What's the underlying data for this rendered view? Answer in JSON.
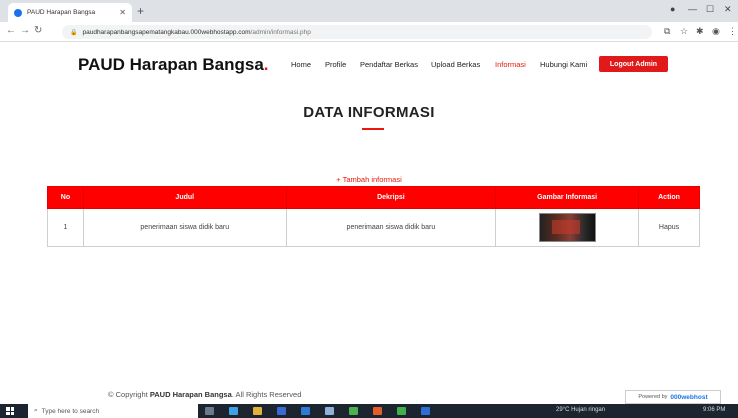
{
  "browser": {
    "tab_title": "PAUD Harapan Bangsa",
    "url_host": "paudharapanbangsapematangkabau.000webhostapp.com",
    "url_path": "/admin/informasi.php"
  },
  "site": {
    "brand": "PAUD Harapan Bangsa",
    "brand_dot": ".",
    "menu": [
      "Home",
      "Profile",
      "Pendaftar Berkas",
      "Upload Berkas",
      "Informasi",
      "Hubungi Kami"
    ],
    "logout_label": "Logout Admin"
  },
  "main": {
    "title": "DATA INFORMASI",
    "add_link": "+  Tambah informasi",
    "table": {
      "headers": [
        "No",
        "Judul",
        "Dekripsi",
        "Gambar Informasi",
        "Action"
      ],
      "rows": [
        {
          "no": "1",
          "judul": "penerimaan siswa didik baru",
          "deskripsi": "penerimaan siswa didik baru",
          "action": "Hapus"
        }
      ]
    }
  },
  "footer": {
    "copyright_prefix": "© Copyright",
    "copyright_brand": "PAUD Harapan Bangsa",
    "copyright_suffix": ". All Rights Reserved",
    "powered_by": "Powered by",
    "powered_host": "000webhost"
  },
  "taskbar": {
    "search_placeholder": "Type here to search",
    "weather": "29°C  Hujan ringan",
    "time": "9:06 PM"
  },
  "colors": {
    "accent": "#e8190a",
    "header_red": "#ff0000"
  }
}
